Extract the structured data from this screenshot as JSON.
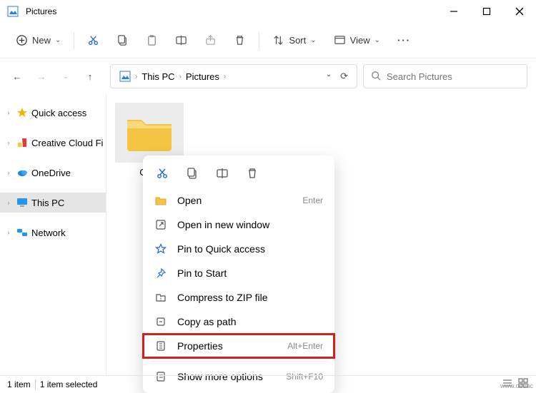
{
  "window": {
    "title": "Pictures"
  },
  "toolbar": {
    "new_label": "New",
    "sort_label": "Sort",
    "view_label": "View"
  },
  "breadcrumbs": {
    "root": "This PC",
    "current": "Pictures"
  },
  "search": {
    "placeholder": "Search Pictures"
  },
  "sidebar": {
    "items": [
      {
        "label": "Quick access"
      },
      {
        "label": "Creative Cloud Fi"
      },
      {
        "label": "OneDrive"
      },
      {
        "label": "This PC"
      },
      {
        "label": "Network"
      }
    ]
  },
  "folder": {
    "name": "Cam"
  },
  "context_menu": {
    "items": [
      {
        "label": "Open",
        "hint": "Enter"
      },
      {
        "label": "Open in new window",
        "hint": ""
      },
      {
        "label": "Pin to Quick access",
        "hint": ""
      },
      {
        "label": "Pin to Start",
        "hint": ""
      },
      {
        "label": "Compress to ZIP file",
        "hint": ""
      },
      {
        "label": "Copy as path",
        "hint": ""
      },
      {
        "label": "Properties",
        "hint": "Alt+Enter",
        "highlight": true
      },
      {
        "label": "Show more options",
        "hint": "Shift+F10"
      }
    ]
  },
  "status": {
    "count": "1 item",
    "selected": "1 item selected"
  },
  "watermark": "www.deuac",
  "colors": {
    "highlight": "#d21f1f",
    "selection": "#e5e5e5"
  }
}
